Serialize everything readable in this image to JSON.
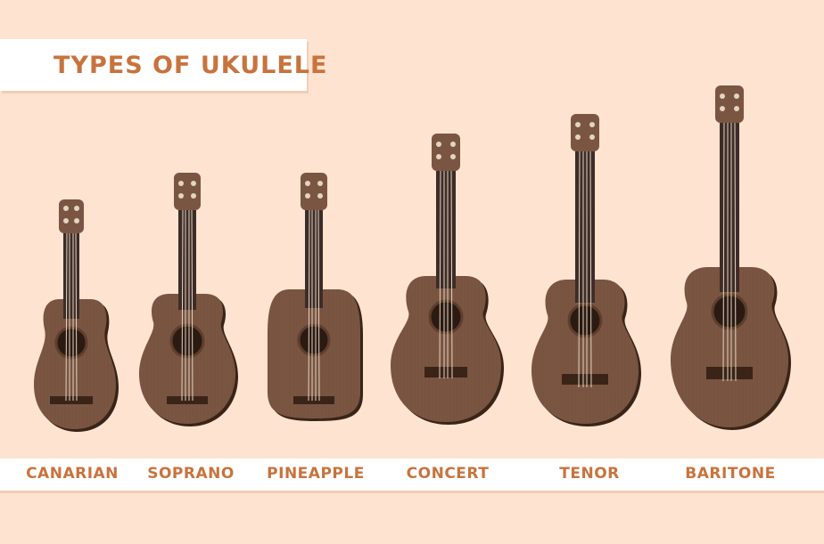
{
  "title": "TYPES OF UKULELE",
  "ukuleles": [
    {
      "name": "CANARIAN"
    },
    {
      "name": "SOPRANO"
    },
    {
      "name": "PINEAPPLE"
    },
    {
      "name": "CONCERT"
    },
    {
      "name": "TENOR"
    },
    {
      "name": "BARITONE"
    }
  ],
  "colors": {
    "background": "#fde3d0",
    "accent": "#c8733d",
    "wood_body": "#7a5642",
    "wood_dark": "#3a2418",
    "fretboard": "#3d2c27",
    "string": "#e4d4c2"
  }
}
